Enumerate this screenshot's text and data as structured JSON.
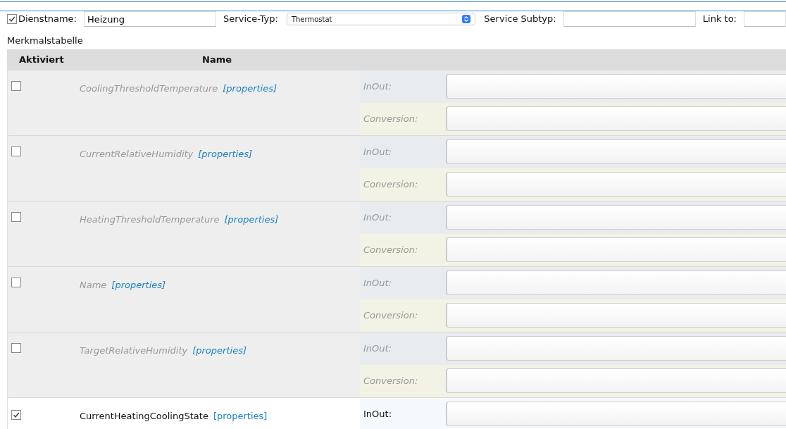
{
  "service": {
    "enabled": true,
    "name_label": "Dienstname:",
    "name_value": "Heizung",
    "type_label": "Service-Typ:",
    "type_value": "Thermostat",
    "subtype_label": "Service Subtyp:",
    "link_label": "Link to:"
  },
  "table_title": "Merkmalstabelle",
  "columns": [
    "Aktiviert",
    "Name"
  ],
  "characteristics": [
    {
      "name": "CoolingThresholdTemperature",
      "link": "[properties]",
      "activated": false,
      "fields": [
        {
          "label": "InOut:"
        },
        {
          "label": "Conversion:"
        }
      ]
    },
    {
      "name": "CurrentRelativeHumidity",
      "link": "[properties]",
      "activated": false,
      "fields": [
        {
          "label": "InOut:"
        },
        {
          "label": "Conversion:"
        }
      ]
    },
    {
      "name": "HeatingThresholdTemperature",
      "link": "[properties]",
      "activated": false,
      "fields": [
        {
          "label": "InOut:"
        },
        {
          "label": "Conversion:"
        }
      ]
    },
    {
      "name": "Name",
      "link": "[properties]",
      "activated": false,
      "fields": [
        {
          "label": "InOut:"
        },
        {
          "label": "Conversion:"
        }
      ]
    },
    {
      "name": "TargetRelativeHumidity",
      "link": "[properties]",
      "activated": false,
      "fields": [
        {
          "label": "InOut:"
        },
        {
          "label": "Conversion:"
        }
      ]
    },
    {
      "name": "CurrentHeatingCoolingState",
      "link": "[properties]",
      "activated": true,
      "fields": [
        {
          "label": "InOut:"
        }
      ]
    }
  ]
}
